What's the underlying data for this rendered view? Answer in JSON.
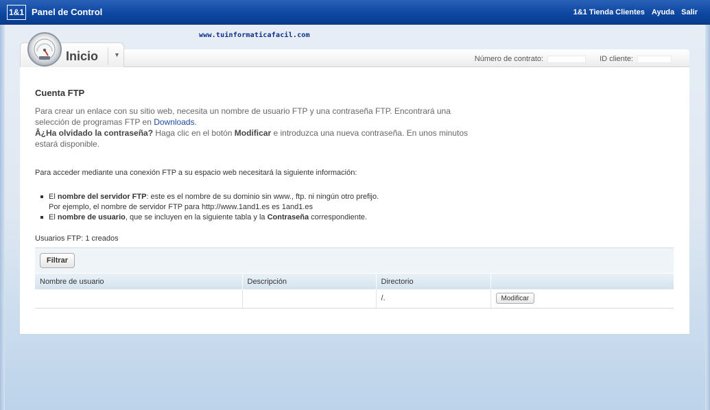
{
  "topbar": {
    "logo": "1&1",
    "title": "Panel de Control",
    "links": [
      "1&1 Tienda Clientes",
      "Ayuda",
      "Salir"
    ]
  },
  "watermark": "www.tuinformaticafacil.com",
  "header": {
    "tab_label": "Inicio",
    "contract_label": "Número de contrato:",
    "client_label": "ID cliente:"
  },
  "content": {
    "title": "Cuenta FTP",
    "intro_1": "Para crear un enlace con su sitio web, necesita un nombre de usuario FTP y una contraseña FTP. Encontrará una selección de programas FTP en ",
    "intro_link": "Downloads",
    "intro_2": ".",
    "forgot_bold": "Â¿Ha olvidado la contraseña?",
    "forgot_1": " Haga clic en el botón ",
    "forgot_modify": "Modificar",
    "forgot_2": " e introduzca una nueva contraseña. En unos minutos estará disponible.",
    "info_line": "Para acceder mediante una conexión FTP a su espacio web necesitará la siguiente información:",
    "bullet1_pre": "El ",
    "bullet1_bold": "nombre del servidor FTP",
    "bullet1_post": ": este es el nombre de su dominio sin www., ftp. ni ningún otro prefijo.",
    "bullet1_cont": "Por ejemplo, el nombre de servidor FTP para http://www.1and1.es es 1and1.es",
    "bullet2_pre": "El ",
    "bullet2_bold": "nombre de usuario",
    "bullet2_mid": ", que se incluyen en la siguiente tabla y la ",
    "bullet2_bold2": "Contraseña",
    "bullet2_post": " correspondiente.",
    "count_line": "Usuarios FTP: 1 creados",
    "filter_label": "Filtrar"
  },
  "table": {
    "headers": [
      "Nombre de usuario",
      "Descripción",
      "Directorio",
      ""
    ],
    "rows": [
      {
        "username": "",
        "description": "",
        "directory": "/.",
        "action": "Modificar"
      }
    ]
  }
}
